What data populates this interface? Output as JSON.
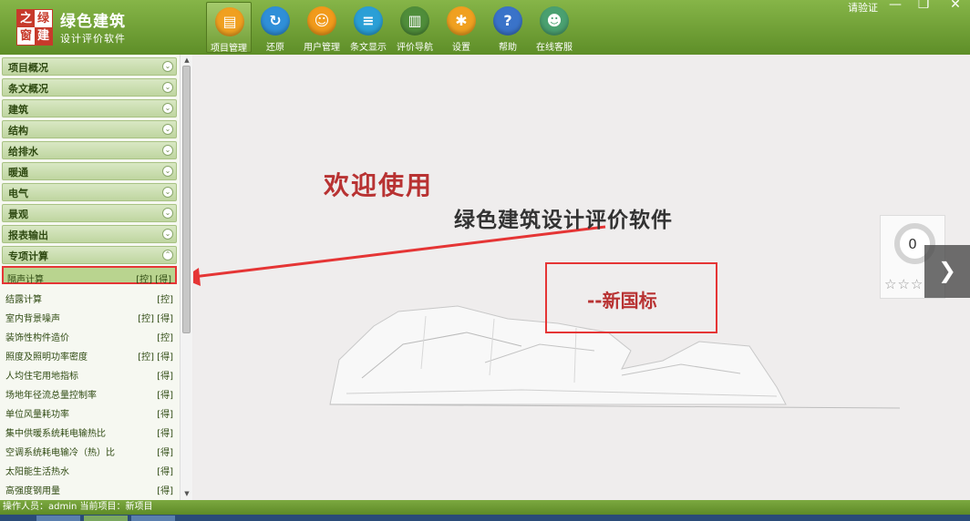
{
  "app": {
    "logo_chars": [
      "之",
      "绿",
      "窗",
      "建"
    ],
    "title": "绿色建筑",
    "subtitle": "设计评价软件",
    "verify": "请验证",
    "window_controls": [
      "—",
      "❐",
      "✕"
    ]
  },
  "toolbar": [
    {
      "label": "项目管理",
      "icon": "folder-icon",
      "color": "#f0a020"
    },
    {
      "label": "还原",
      "icon": "restore-icon",
      "color": "#2f8fd8"
    },
    {
      "label": "用户管理",
      "icon": "user-icon",
      "color": "#f19a1b"
    },
    {
      "label": "条文显示",
      "icon": "document-icon",
      "color": "#2a9fd6"
    },
    {
      "label": "评价导航",
      "icon": "book-icon",
      "color": "#4f8d3a"
    },
    {
      "label": "设置",
      "icon": "gear-icon",
      "color": "#f0a020"
    },
    {
      "label": "帮助",
      "icon": "help-icon",
      "color": "#3a73c9"
    },
    {
      "label": "在线客服",
      "icon": "support-icon",
      "color": "#4aa070"
    }
  ],
  "sidebar": {
    "categories": [
      "项目概况",
      "条文概况",
      "建筑",
      "结构",
      "给排水",
      "暖通",
      "电气",
      "景观",
      "报表输出",
      "专项计算"
    ],
    "items": [
      {
        "label": "隔声计算",
        "tags": "[控] [得]"
      },
      {
        "label": "结露计算",
        "tags": "[控]"
      },
      {
        "label": "室内背景噪声",
        "tags": "[控] [得]"
      },
      {
        "label": "装饰性构件造价",
        "tags": "[控]"
      },
      {
        "label": "照度及照明功率密度",
        "tags": "[控] [得]"
      },
      {
        "label": "人均住宅用地指标",
        "tags": "[得]"
      },
      {
        "label": "场地年径流总量控制率",
        "tags": "[得]"
      },
      {
        "label": "单位风量耗功率",
        "tags": "[得]"
      },
      {
        "label": "集中供暖系统耗电输热比",
        "tags": "[得]"
      },
      {
        "label": "空调系统耗电输冷（热）比",
        "tags": "[得]"
      },
      {
        "label": "太阳能生活热水",
        "tags": "[得]"
      },
      {
        "label": "高强度钢用量",
        "tags": "[得]"
      }
    ]
  },
  "main": {
    "welcome": "欢迎使用",
    "slogan": "绿色建筑设计评价软件",
    "version": "--新国标",
    "widget_count": "0",
    "stars": "☆☆☆",
    "next_glyph": "❯"
  },
  "status": {
    "text": "操作人员：admin   当前项目：新项目"
  }
}
